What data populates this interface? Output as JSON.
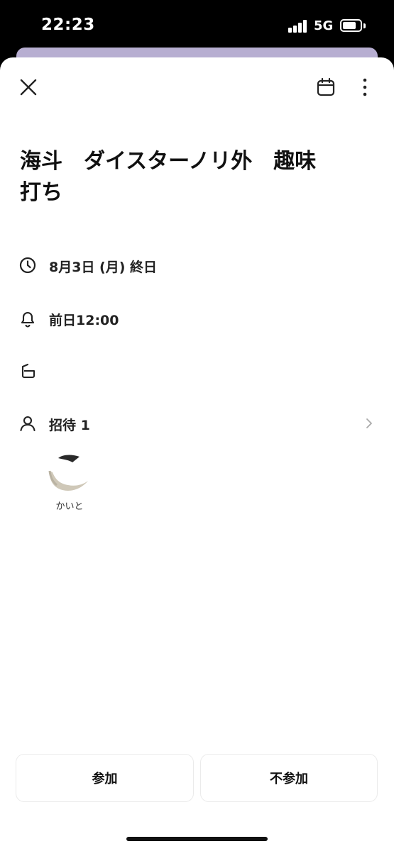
{
  "status_bar": {
    "time": "22:23",
    "network": "5G",
    "signal_bars": 4,
    "battery_level": 0.65
  },
  "header": {
    "icons": [
      "close-icon",
      "calendar-icon",
      "more-vertical-icon"
    ]
  },
  "event": {
    "title": "海斗　ダイスターノリ外　趣味打ち",
    "date": "8月3日 (月) 終日",
    "reminder": "前日12:00",
    "calendar": "",
    "invite_label": "招待 1",
    "invitees": [
      {
        "name": "かいと"
      }
    ]
  },
  "actions": {
    "join_label": "参加",
    "decline_label": "不参加"
  },
  "colors": {
    "accent_behind": "#b7aed1",
    "text": "#111111",
    "button_border": "#ebebeb"
  }
}
